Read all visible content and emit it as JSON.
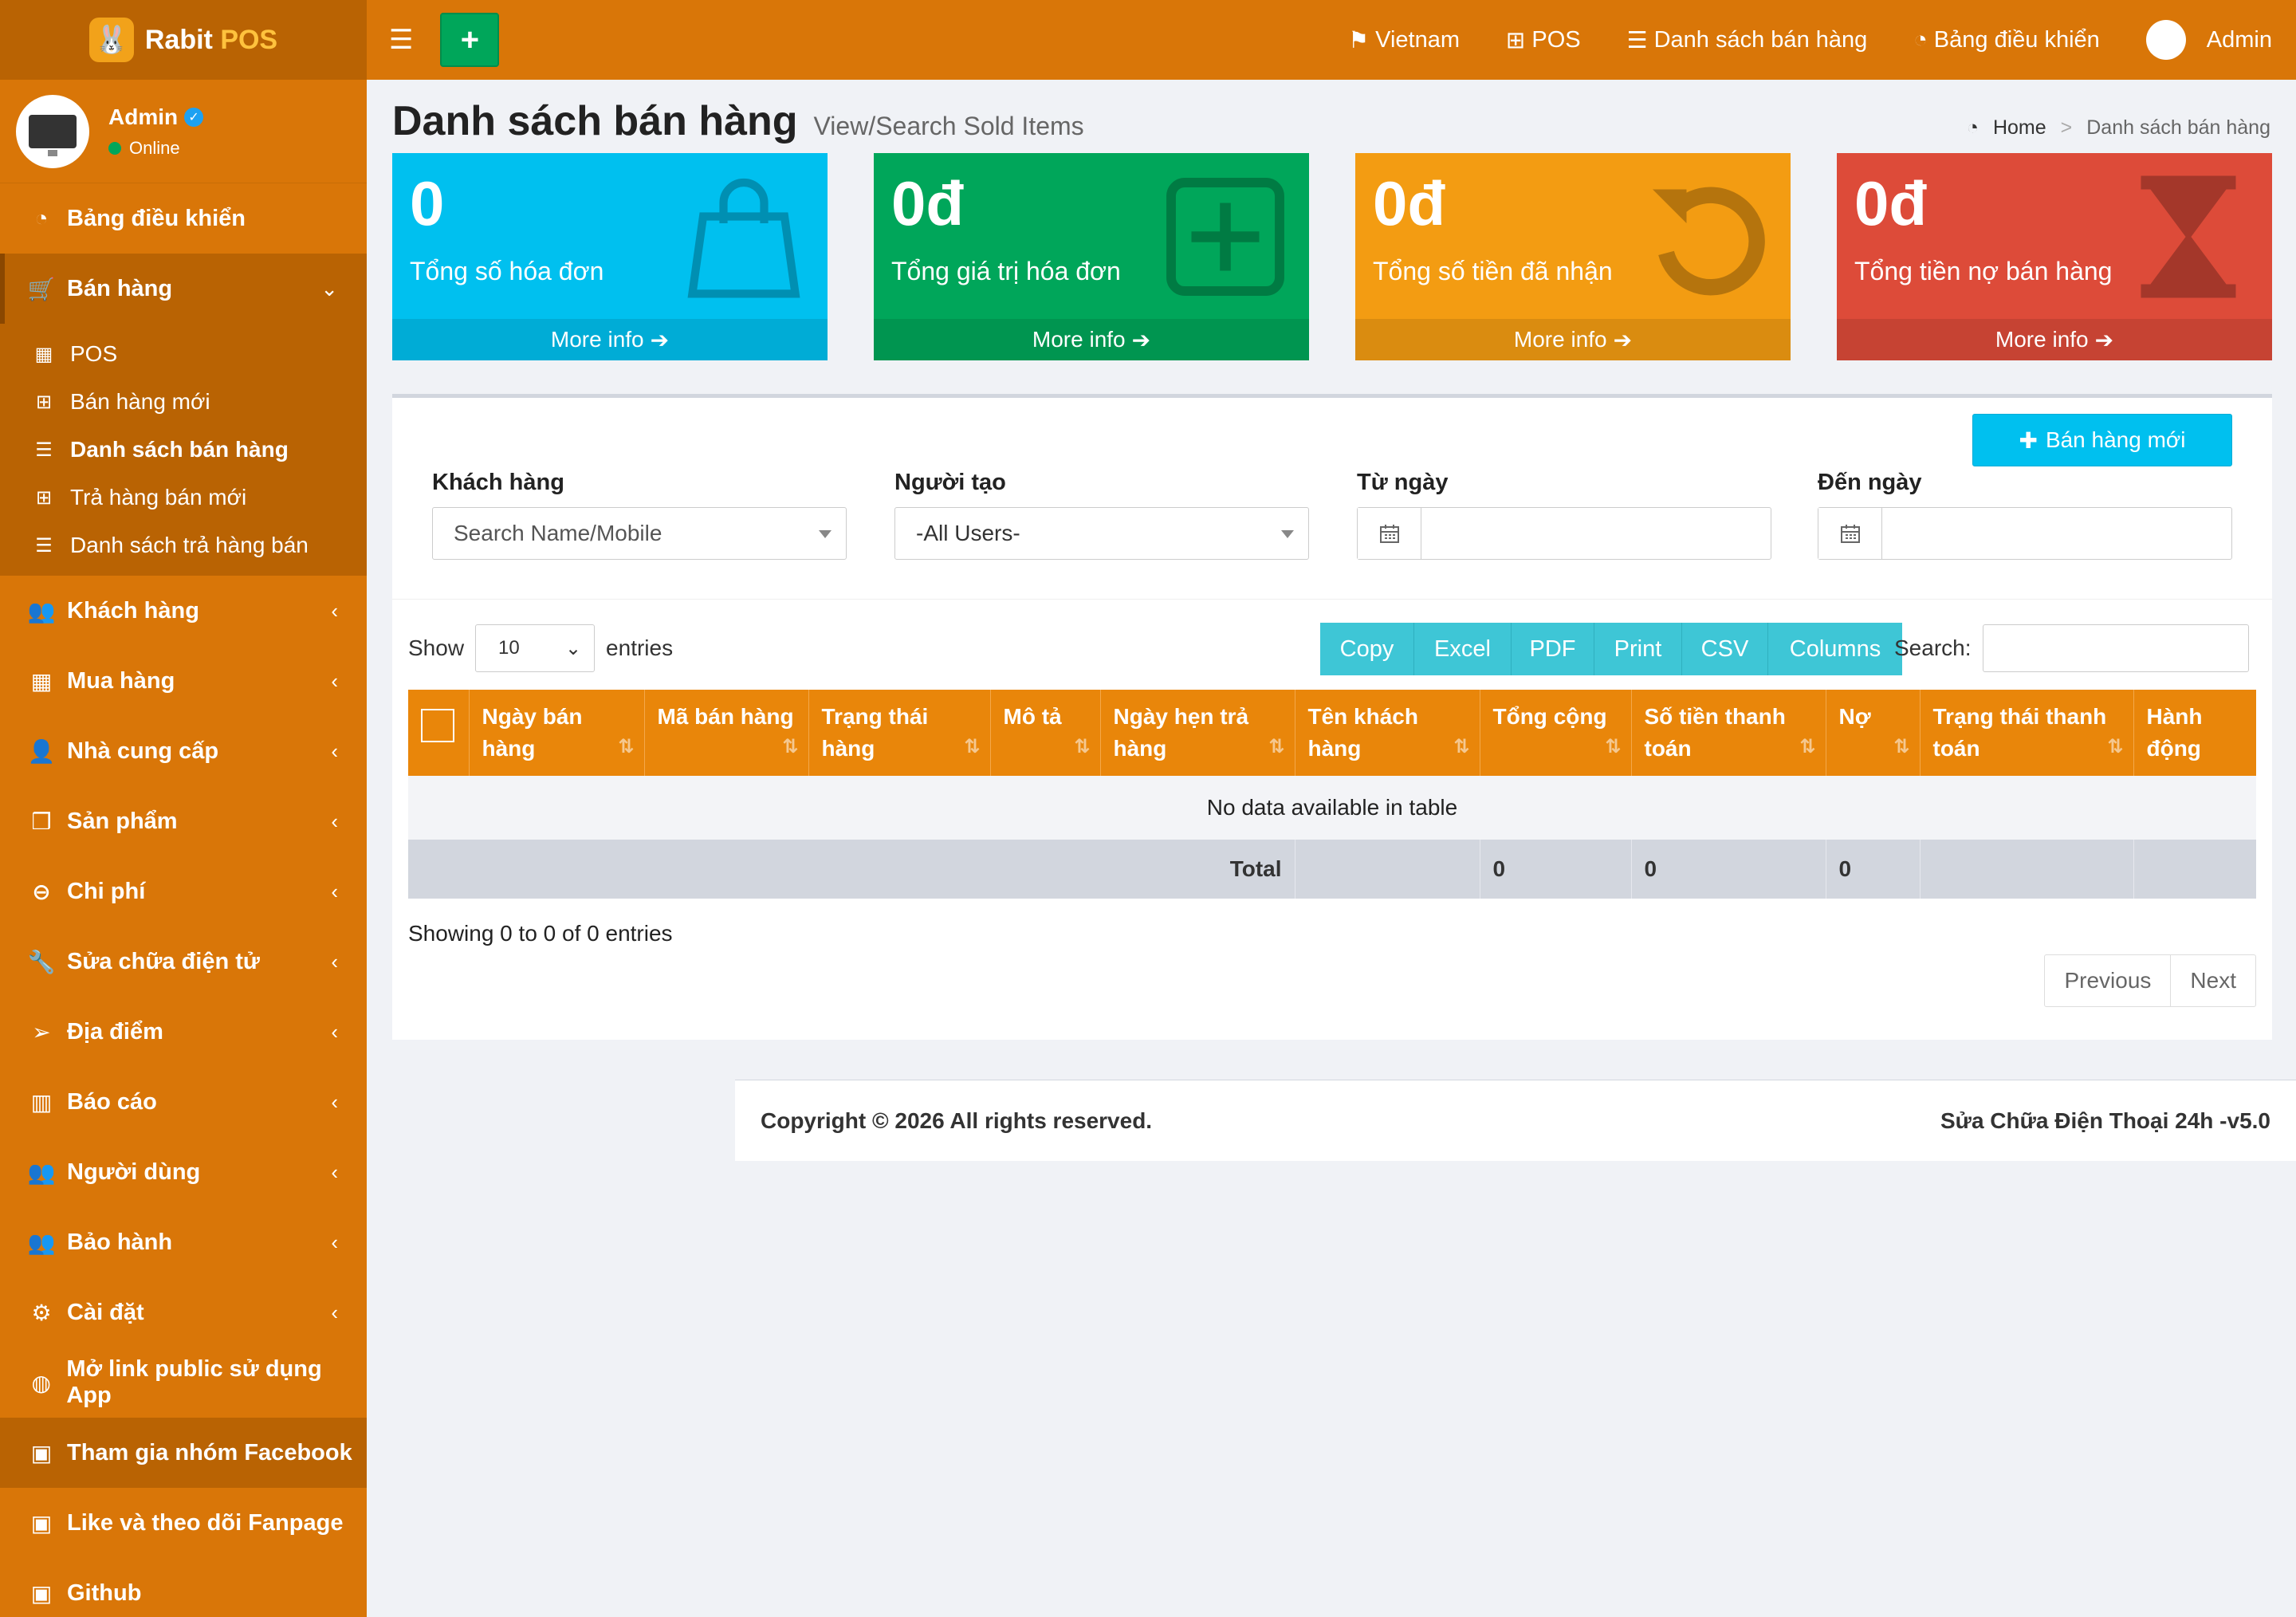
{
  "app": {
    "name_part1": "Rabit",
    "name_part2": "POS"
  },
  "user": {
    "name": "Admin",
    "status": "Online"
  },
  "sidebar": {
    "items": [
      {
        "label": "Bảng điều khiển",
        "icon": "dashboard-icon"
      },
      {
        "label": "Bán hàng",
        "icon": "cart-icon",
        "open": true
      },
      {
        "label": "Khách hàng",
        "icon": "users-icon"
      },
      {
        "label": "Mua hàng",
        "icon": "grid-icon"
      },
      {
        "label": "Nhà cung cấp",
        "icon": "user-plus-icon"
      },
      {
        "label": "Sản phẩm",
        "icon": "cubes-icon"
      },
      {
        "label": "Chi phí",
        "icon": "minus-circle-icon"
      },
      {
        "label": "Sửa chữa điện tử",
        "icon": "wrench-icon"
      },
      {
        "label": "Địa điểm",
        "icon": "paper-plane-icon"
      },
      {
        "label": "Báo cáo",
        "icon": "bar-chart-icon"
      },
      {
        "label": "Người dùng",
        "icon": "users-icon"
      },
      {
        "label": "Bảo hành",
        "icon": "users-icon"
      },
      {
        "label": "Cài đặt",
        "icon": "cogs-icon"
      },
      {
        "label": "Mở link public sử dụng App",
        "icon": "globe-icon"
      },
      {
        "label": "Tham gia nhóm Facebook",
        "icon": "briefcase-icon"
      },
      {
        "label": "Like và theo dõi Fanpage",
        "icon": "briefcase-icon"
      },
      {
        "label": "Github",
        "icon": "briefcase-icon"
      }
    ],
    "submenu": [
      {
        "label": "POS",
        "icon": "calculator-icon"
      },
      {
        "label": "Bán hàng mới",
        "icon": "plus-square-icon"
      },
      {
        "label": "Danh sách bán hàng",
        "icon": "list-icon",
        "active": true
      },
      {
        "label": "Trả hàng bán mới",
        "icon": "plus-square-icon"
      },
      {
        "label": "Danh sách trả hàng bán",
        "icon": "list-icon"
      }
    ]
  },
  "topnav": {
    "add_label": "+",
    "language": "Vietnam",
    "pos": "POS",
    "sales_list": "Danh sách bán hàng",
    "dashboard": "Bảng điều khiển",
    "user": "Admin"
  },
  "page": {
    "title": "Danh sách bán hàng",
    "subtitle": "View/Search Sold Items",
    "breadcrumb": {
      "home": "Home",
      "sep": ">",
      "current": "Danh sách bán hàng"
    }
  },
  "stats": [
    {
      "value": "0",
      "label": "Tổng số hóa đơn",
      "more": "More info",
      "color": "#00c0ef",
      "icon": "shopping-bag-icon"
    },
    {
      "value": "0đ",
      "label": "Tổng giá trị hóa đơn",
      "more": "More info",
      "color": "#00a65a",
      "icon": "plus-square-icon"
    },
    {
      "value": "0đ",
      "label": "Tổng số tiền đã nhận",
      "more": "More info",
      "color": "#f39c12",
      "icon": "undo-icon"
    },
    {
      "value": "0đ",
      "label": "Tổng tiền nợ bán hàng",
      "more": "More info",
      "color": "#dd4b39",
      "icon": "hourglass-icon"
    }
  ],
  "filters": {
    "new_sale_button": "Bán hàng mới",
    "customer_label": "Khách hàng",
    "customer_placeholder": "Search Name/Mobile",
    "creator_label": "Người tạo",
    "creator_value": "-All Users-",
    "from_label": "Từ ngày",
    "to_label": "Đến ngày"
  },
  "datatable": {
    "show_label": "Show",
    "length_value": "10",
    "entries_label": "entries",
    "buttons": [
      "Copy",
      "Excel",
      "PDF",
      "Print",
      "CSV",
      "Columns"
    ],
    "search_label": "Search:",
    "columns": [
      "Ngày bán hàng",
      "Mã bán hàng",
      "Trạng thái hàng",
      "Mô tả",
      "Ngày hẹn trả hàng",
      "Tên khách hàng",
      "Tổng cộng",
      "Số tiền thanh toán",
      "Nợ",
      "Trạng thái thanh toán",
      "Hành động"
    ],
    "empty_text": "No data available in table",
    "total_label": "Total",
    "totals": {
      "total": "0",
      "paid": "0",
      "debt": "0"
    },
    "info": "Showing 0 to 0 of 0 entries",
    "prev": "Previous",
    "next": "Next"
  },
  "footer": {
    "copyright": "Copyright © 2026 All rights reserved.",
    "version": "Sửa Chữa Điện Thoại 24h -v5.0"
  },
  "colors": {
    "primary": "#d97608",
    "sidebar_dark": "#b96303",
    "table_header": "#e9860a",
    "button_cyan": "#3ec6d6"
  }
}
